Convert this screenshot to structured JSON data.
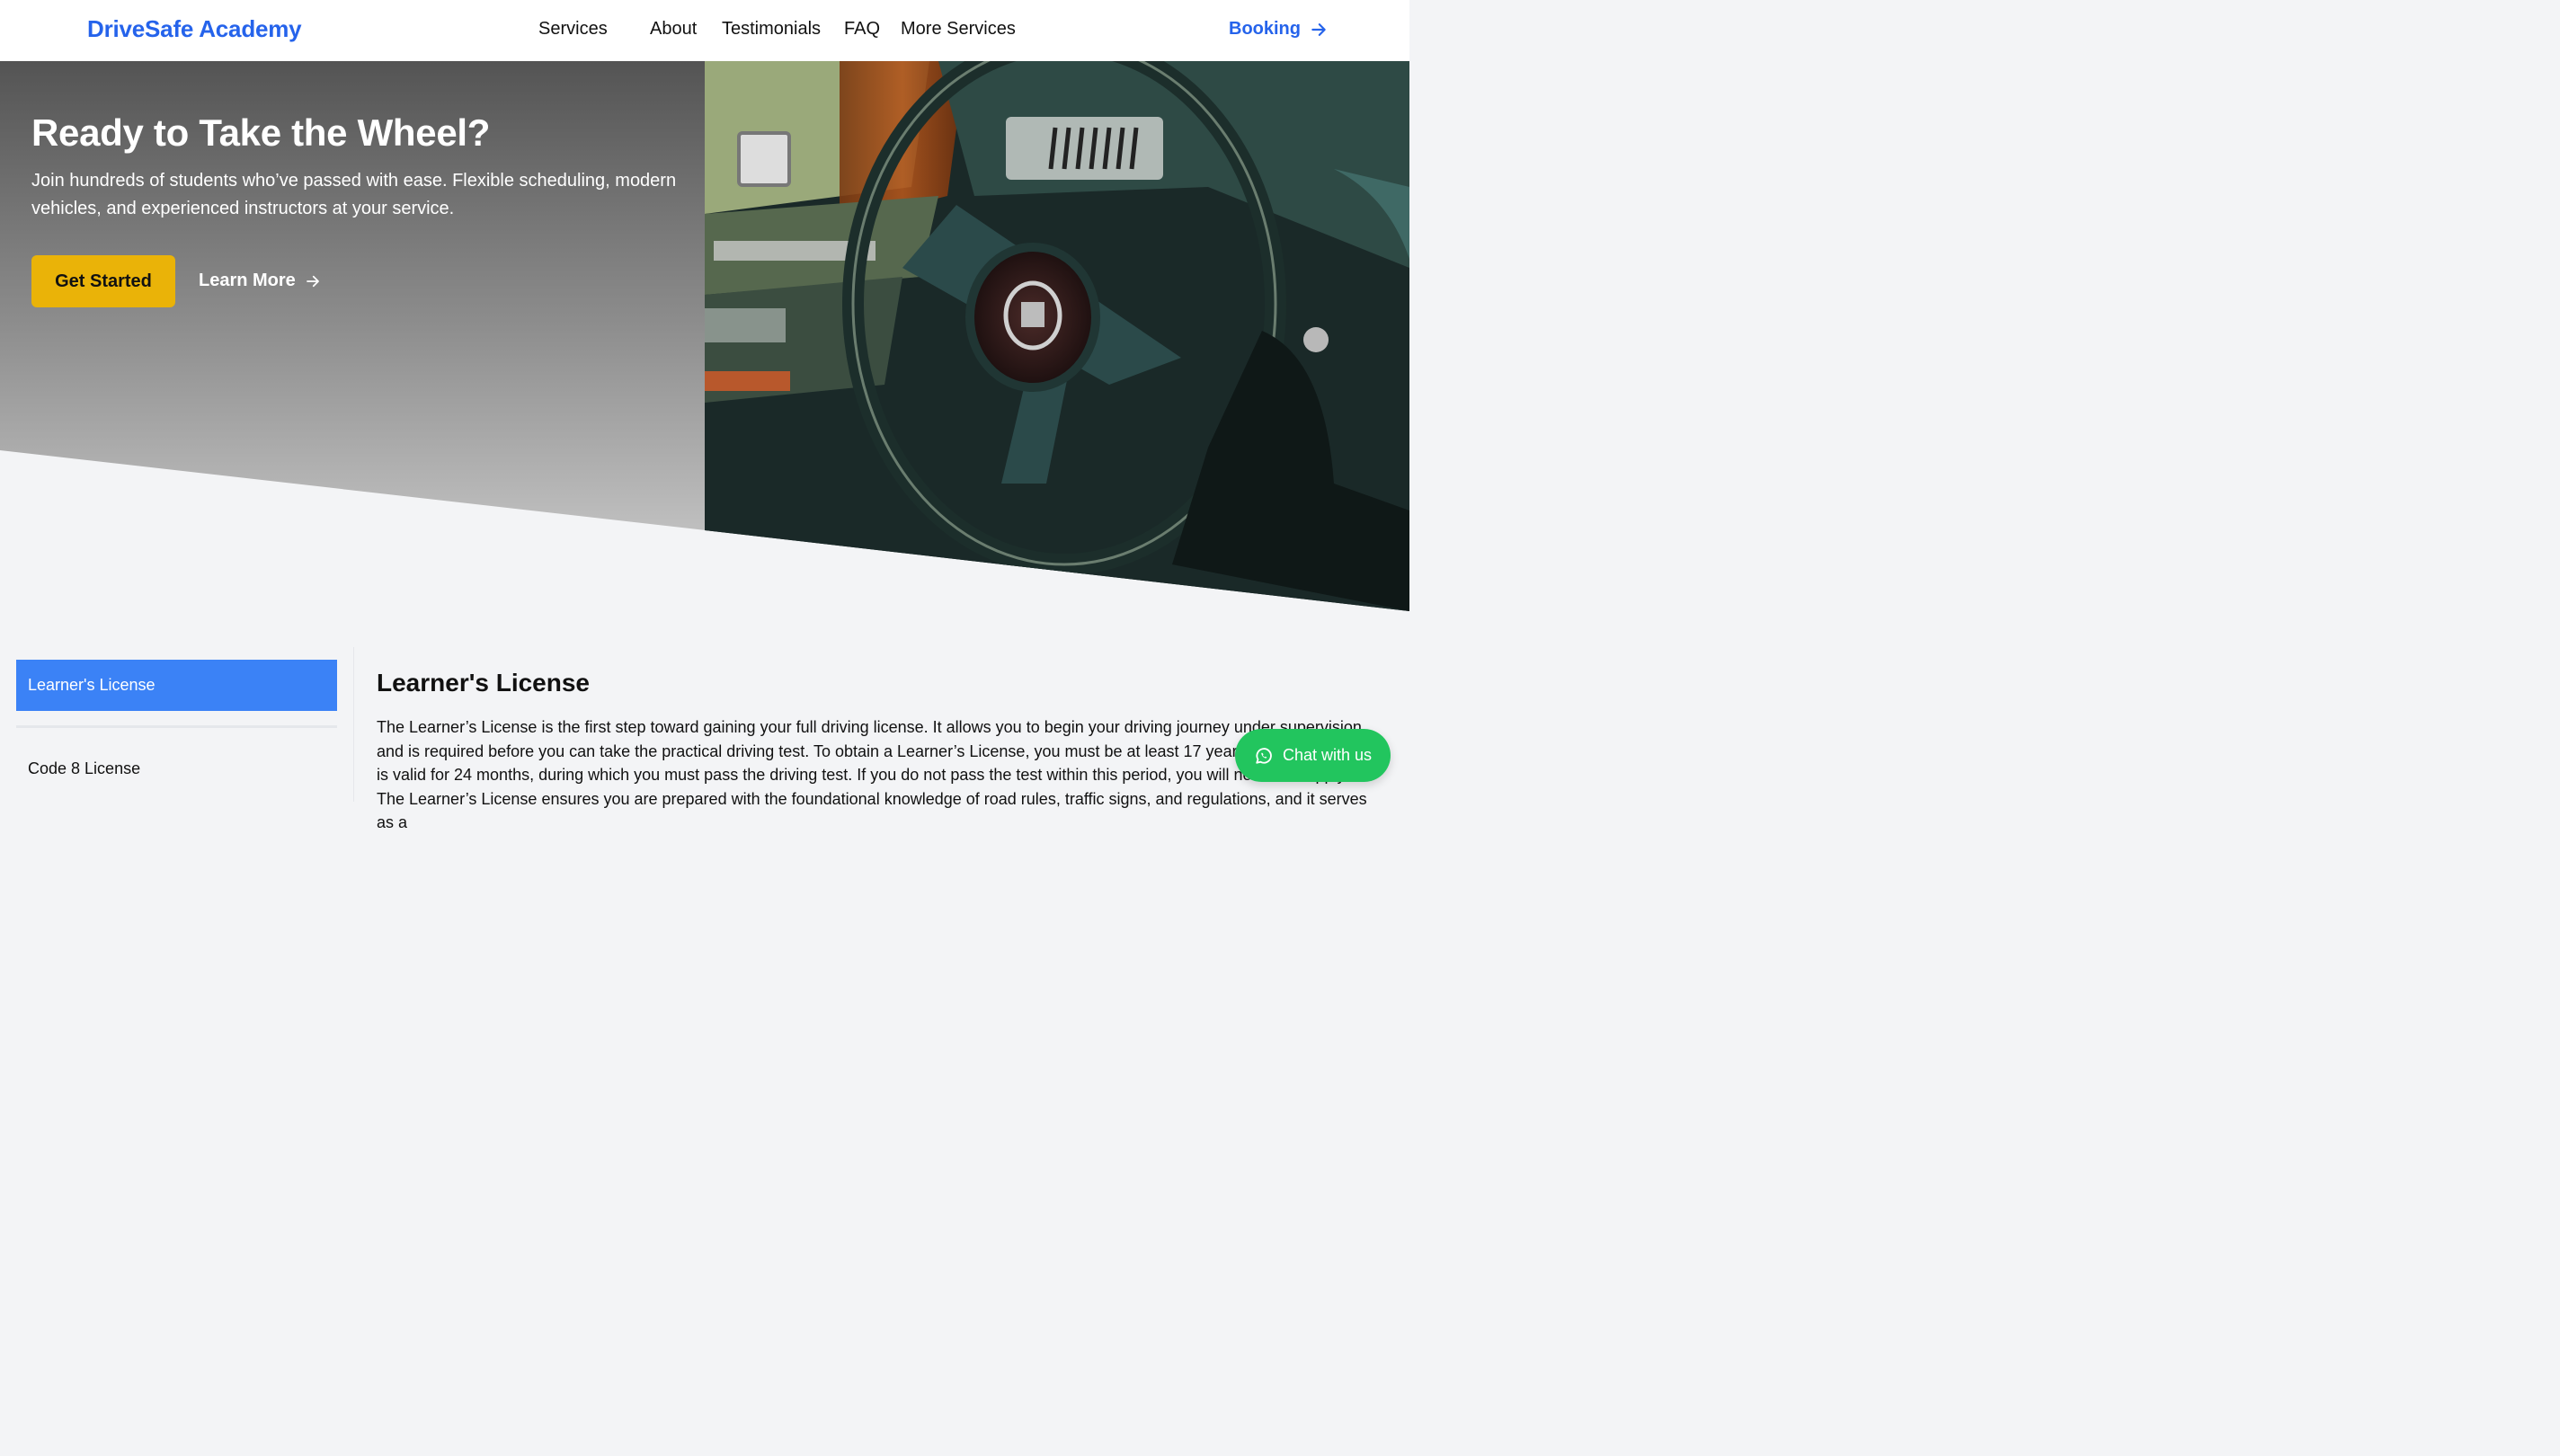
{
  "nav": {
    "brand": "DriveSafe Academy",
    "links": [
      "Services",
      "About",
      "Testimonials",
      "FAQ",
      "More Services"
    ],
    "booking_label": "Booking"
  },
  "hero": {
    "title": "Ready to Take the Wheel?",
    "subtitle": "Join hundreds of students who’ve passed with ease. Flexible scheduling, modern vehicles, and experienced instructors at your service.",
    "primary_button": "Get Started",
    "secondary_button": "Learn More",
    "image_icon": "steering-wheel-photo"
  },
  "sidebar": {
    "items": [
      "Learner's License",
      "Code 8 License"
    ],
    "active_index": 0
  },
  "content": {
    "title": "Learner's License",
    "body": "The Learner’s License is the first step toward gaining your full driving license. It allows you to begin your driving journey under supervision and is required before you can take the practical driving test. To obtain a Learner’s License, you must be at least 17 years old. The license is valid for 24 months, during which you must pass the driving test. If you do not pass the test within this period, you will need to reapply. The Learner’s License ensures you are prepared with the foundational knowledge of road rules, traffic signs, and regulations, and it serves as a"
  },
  "chat": {
    "label": "Chat with us",
    "icon": "whatsapp-icon"
  },
  "colors": {
    "brand": "#2563eb",
    "primary_button": "#eab308",
    "sidebar_active": "#3b82f6",
    "chat": "#22c55e"
  }
}
